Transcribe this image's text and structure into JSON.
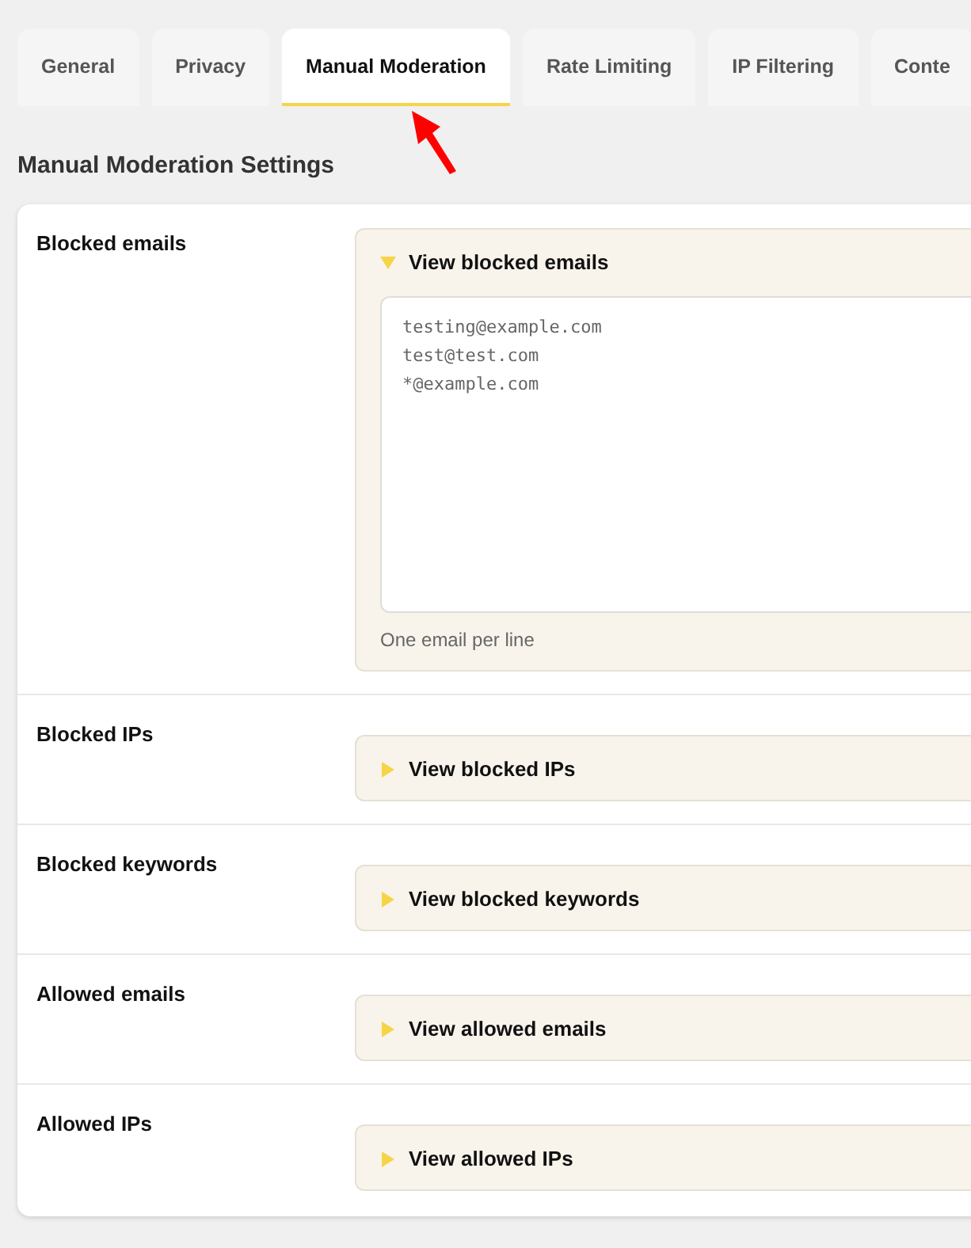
{
  "tabs": [
    {
      "label": "General",
      "selected": false
    },
    {
      "label": "Privacy",
      "selected": false
    },
    {
      "label": "Manual Moderation",
      "selected": true
    },
    {
      "label": "Rate Limiting",
      "selected": false
    },
    {
      "label": "IP Filtering",
      "selected": false
    },
    {
      "label": "Conte",
      "selected": false
    }
  ],
  "heading": "Manual Moderation Settings",
  "settings": [
    {
      "label": "Blocked emails",
      "summary": "View blocked emails",
      "expanded": true,
      "value": "testing@example.com\ntest@test.com\n*@example.com",
      "hint": "One email per line"
    },
    {
      "label": "Blocked IPs",
      "summary": "View blocked IPs",
      "expanded": false
    },
    {
      "label": "Blocked keywords",
      "summary": "View blocked keywords",
      "expanded": false
    },
    {
      "label": "Allowed emails",
      "summary": "View allowed emails",
      "expanded": false
    },
    {
      "label": "Allowed IPs",
      "summary": "View allowed IPs",
      "expanded": false
    }
  ]
}
